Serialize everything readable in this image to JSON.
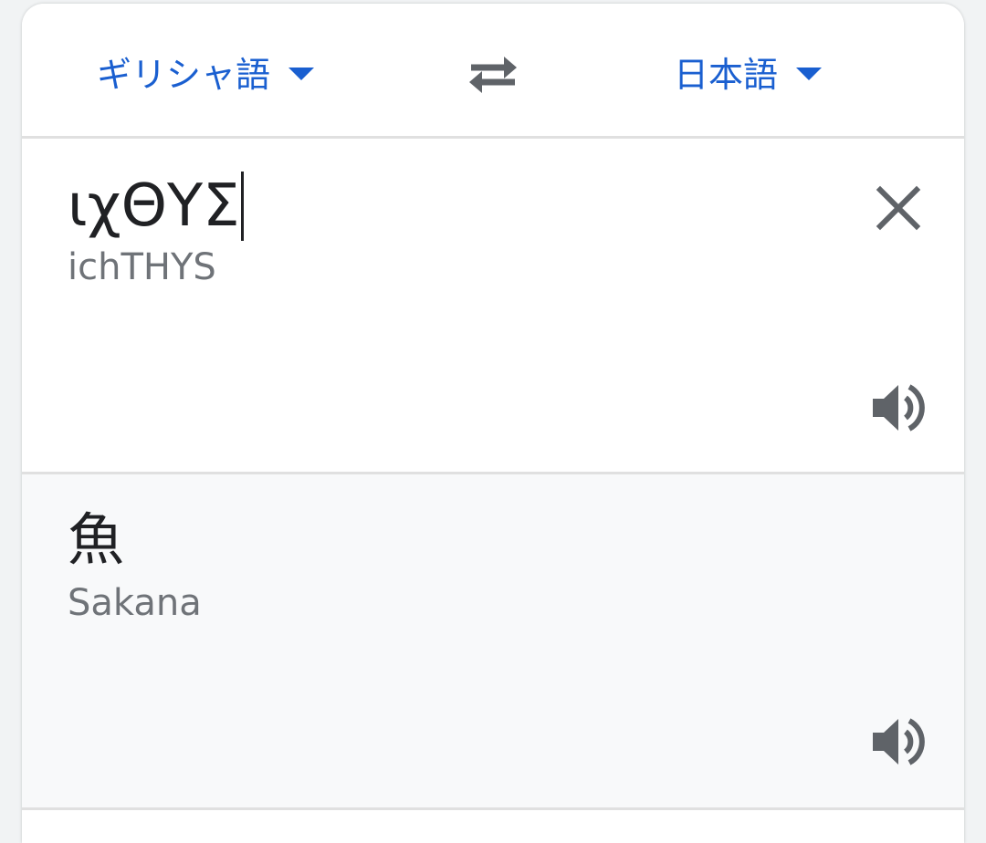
{
  "language_bar": {
    "source_language": "ギリシャ語",
    "target_language": "日本語",
    "swap_icon": "swap-horiz-icon",
    "accent_color": "#1a5fd0"
  },
  "input": {
    "text": "ιχΘΥΣ",
    "transliteration": "ichTHYS",
    "clear_icon": "close-icon",
    "listen_icon": "volume-icon"
  },
  "output": {
    "text": "魚",
    "transliteration": "Sakana",
    "listen_icon": "volume-icon"
  }
}
